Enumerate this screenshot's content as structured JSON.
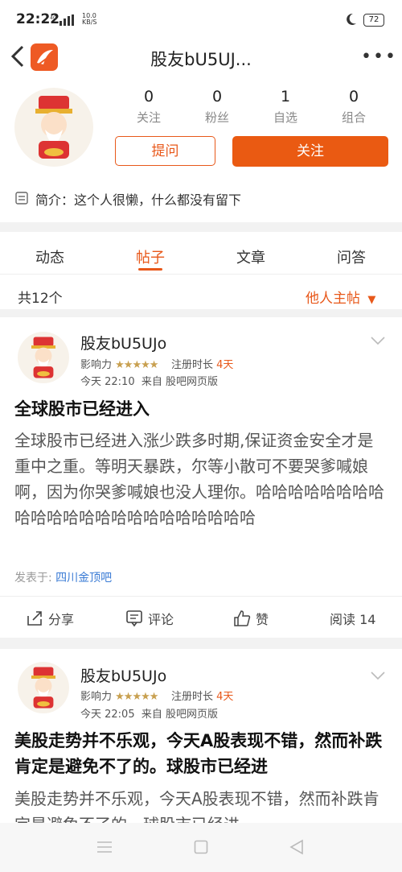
{
  "status_bar": {
    "time": "22:22",
    "net_speed_value": "10.0",
    "net_speed_unit": "KB/S",
    "network": "4G",
    "battery": "72"
  },
  "nav": {
    "title": "股友bU5UJ...",
    "more": "•••"
  },
  "profile": {
    "stats": [
      {
        "value": "0",
        "label": "关注"
      },
      {
        "value": "0",
        "label": "粉丝"
      },
      {
        "value": "1",
        "label": "自选"
      },
      {
        "value": "0",
        "label": "组合"
      }
    ],
    "ask_label": "提问",
    "follow_label": "关注",
    "intro": "简介：这个人很懒，什么都没有留下"
  },
  "tabs": [
    {
      "label": "动态"
    },
    {
      "label": "帖子"
    },
    {
      "label": "文章"
    },
    {
      "label": "问答"
    }
  ],
  "list_header": {
    "count": "共12个",
    "filter": "他人主帖"
  },
  "posts": [
    {
      "author": "股友bU5UJo",
      "influence_label": "影响力",
      "stars": "★★★★★",
      "reg_label": "注册时长",
      "reg_value": "4天",
      "time": "今天 22:10",
      "source": "来自 股吧网页版",
      "title": "全球股市已经进入",
      "body": "全球股市已经进入涨少跌多时期,保证资金安全才是重中之重。等明天暴跌，尔等小散可不要哭爹喊娘啊，因为你哭爹喊娘也没人理你。哈哈哈哈哈哈哈哈哈哈哈哈哈哈哈哈哈哈哈哈哈哈哈",
      "posted_in_label": "发表于:",
      "posted_in": "四川金顶吧",
      "share": "分享",
      "comment": "评论",
      "like": "赞",
      "reads": "阅读 14"
    },
    {
      "author": "股友bU5UJo",
      "influence_label": "影响力",
      "stars": "★★★★★",
      "reg_label": "注册时长",
      "reg_value": "4天",
      "time": "今天 22:05",
      "source": "来自 股吧网页版",
      "title": "美股走势并不乐观，今天A股表现不错，然而补跌肯定是避免不了的。球股市已经进",
      "body": "美股走势并不乐观，今天A股表现不错，然而补跌肯定是避免不了的。球股市已经进"
    }
  ]
}
